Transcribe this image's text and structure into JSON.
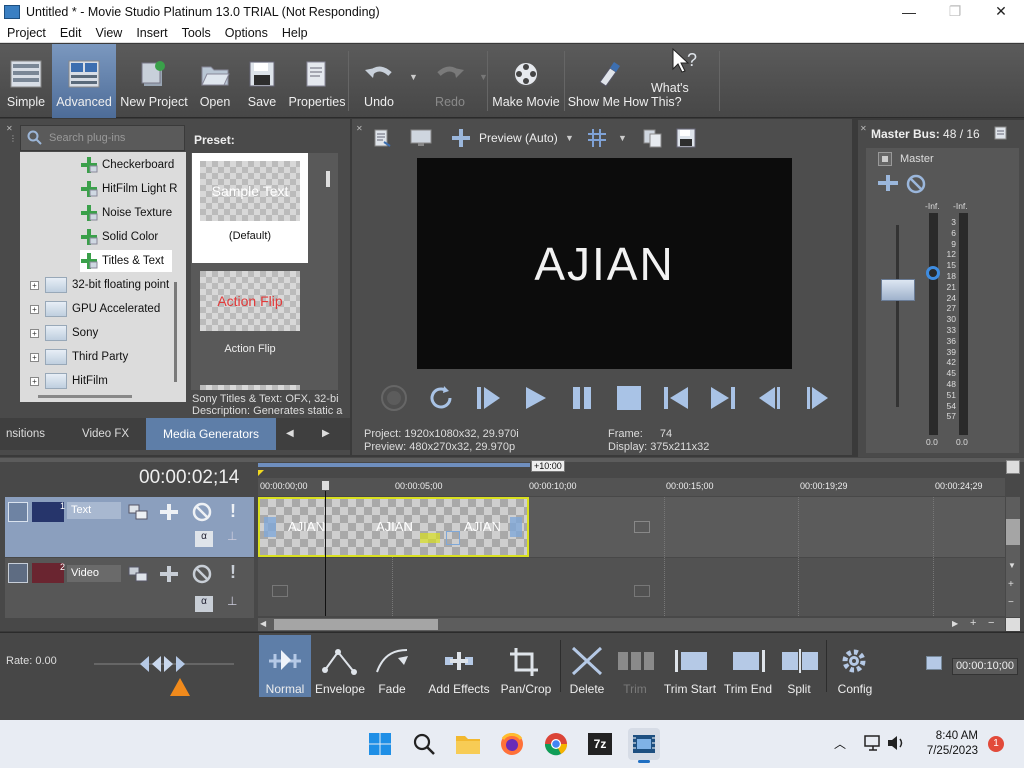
{
  "window": {
    "title": "Untitled * - Movie Studio Platinum 13.0 TRIAL (Not Responding)",
    "minimize": "—",
    "maximize": "❐",
    "close": "✕"
  },
  "menu": [
    "Project",
    "Edit",
    "View",
    "Insert",
    "Tools",
    "Options",
    "Help"
  ],
  "toolbar": {
    "simple": "Simple",
    "advanced": "Advanced",
    "new_project": "New Project",
    "open": "Open",
    "save": "Save",
    "properties": "Properties",
    "undo": "Undo",
    "redo": "Redo",
    "make_movie": "Make Movie",
    "show_me_how": "Show Me How",
    "whats_this": "What's This?"
  },
  "plugins": {
    "search_placeholder": "Search plug-ins",
    "tree": [
      {
        "label": "Checkerboard",
        "type": "plugin"
      },
      {
        "label": "HitFilm Light R",
        "type": "plugin"
      },
      {
        "label": "Noise Texture",
        "type": "plugin"
      },
      {
        "label": "Solid Color",
        "type": "plugin"
      },
      {
        "label": "Titles & Text",
        "type": "plugin",
        "selected": true
      },
      {
        "label": "32-bit floating point",
        "type": "folder"
      },
      {
        "label": "GPU Accelerated",
        "type": "folder"
      },
      {
        "label": "Sony",
        "type": "folder"
      },
      {
        "label": "Third Party",
        "type": "folder"
      },
      {
        "label": "HitFilm",
        "type": "folder"
      }
    ],
    "preset_label": "Preset:",
    "presets": [
      {
        "thumb_text": "Sample Text",
        "name": "(Default)"
      },
      {
        "thumb_text": "Action Flip",
        "name": "Action Flip"
      }
    ],
    "description_line1": "Sony Titles & Text: OFX, 32-bi",
    "description_line2": "Description: Generates static a"
  },
  "panel_tabs": [
    "nsitions",
    "Video FX",
    "Media Generators"
  ],
  "preview": {
    "mode": "Preview (Auto)",
    "frame_text": "AJIAN",
    "project_label": "Project:",
    "project_value": "1920x1080x32, 29.970i",
    "preview_label": "Preview:",
    "preview_value": "480x270x32, 29.970p",
    "frame_label": "Frame:",
    "frame_value": "74",
    "display_label": "Display:",
    "display_value": "375x211x32"
  },
  "master_bus": {
    "title": "Master Bus:",
    "value": "48 / 16",
    "channel": "Master",
    "peak_left": "-Inf.",
    "peak_right": "-Inf.",
    "scale": [
      "3",
      "6",
      "9",
      "12",
      "15",
      "18",
      "21",
      "24",
      "27",
      "30",
      "33",
      "36",
      "39",
      "42",
      "45",
      "48",
      "51",
      "54",
      "57"
    ],
    "level_left": "0.0",
    "level_right": "0.0"
  },
  "timeline": {
    "timecode": "00:00:02;14",
    "offset_badge": "+10:00",
    "ruler": [
      "00:00:00;00",
      "00:00:05;00",
      "00:00:10;00",
      "00:00:15;00",
      "00:00:19;29",
      "00:00:24;29"
    ],
    "tracks": [
      {
        "number": "1",
        "name": "Text"
      },
      {
        "number": "2",
        "name": "Video"
      }
    ],
    "clip_labels": [
      "AJIAN",
      "AJIAN",
      "AJIAN"
    ],
    "rate_label": "Rate: 0.00"
  },
  "edit_tools": {
    "normal": "Normal",
    "envelope": "Envelope",
    "fade": "Fade",
    "add_effects": "Add Effects",
    "pan_crop": "Pan/Crop",
    "delete": "Delete",
    "trim": "Trim",
    "trim_start": "Trim Start",
    "trim_end": "Trim End",
    "split": "Split",
    "config": "Config",
    "duration": "00:00:10;00"
  },
  "taskbar": {
    "time": "8:40 AM",
    "date": "7/25/2023",
    "notifications": "1"
  },
  "colors": {
    "clip_border": "#d9e020",
    "selected_tab": "#5e7ea8",
    "accent_orange": "#f08a1c"
  }
}
